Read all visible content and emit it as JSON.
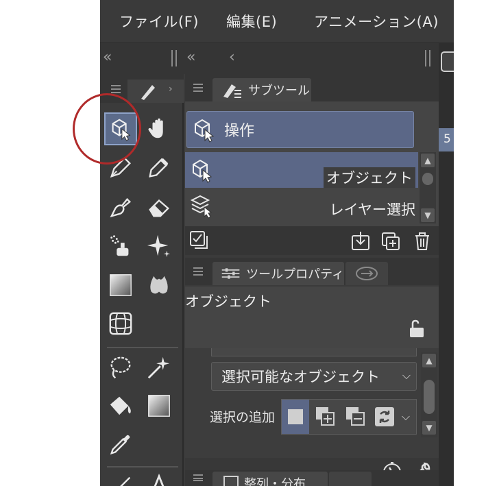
{
  "menubar": {
    "items": [
      "ファイル(F)",
      "編集(E)",
      "アニメーション(A)"
    ]
  },
  "collapse_bar": {
    "left_collapse": "«",
    "right_collapse": "«",
    "back": "‹"
  },
  "right_strip": {
    "number": "5"
  },
  "tools": {
    "selected": "operation-tool",
    "items": [
      "operation",
      "hand",
      "pen",
      "pencil",
      "brush",
      "eraser",
      "airbrush",
      "decoration",
      "gradient",
      "blend",
      "figure",
      "lasso-select",
      "auto-select",
      "fill",
      "gradient-fill",
      "eyedropper",
      "line",
      "text"
    ]
  },
  "sub_tool": {
    "tab_label": "サブツール",
    "group_label": "操作",
    "items": [
      {
        "label": "オブジェクト",
        "selected": true
      },
      {
        "label": "レイヤー選択",
        "selected": false
      }
    ]
  },
  "tool_property": {
    "tab_label": "ツールプロパティ",
    "name": "オブジェクト",
    "dropdown_value": "選択可能なオブジェクト",
    "selection_label": "選択の追加"
  },
  "bottom_panel": {
    "tab_label": "整列・分布"
  },
  "colors": {
    "accent": "#5b6787",
    "annotation": "#b02a2a",
    "panel": "#3b3b3b"
  }
}
